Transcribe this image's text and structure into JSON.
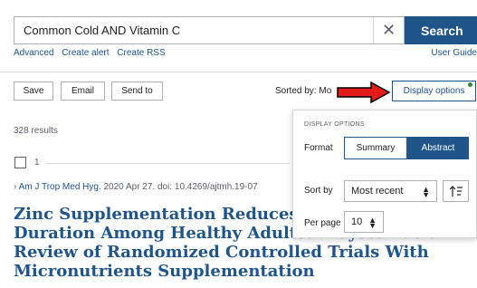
{
  "search": {
    "value": "Common Cold AND Vitamin C",
    "clear_glyph": "✕",
    "button_label": "Search"
  },
  "links": {
    "advanced": "Advanced",
    "create_alert": "Create alert",
    "create_rss": "Create RSS",
    "user_guide": "User Guide"
  },
  "toolbar": {
    "save": "Save",
    "email": "Email",
    "send_to": "Send to",
    "sorted_by": "Sorted by: Mo",
    "display_options": "Display options"
  },
  "results": {
    "count": "328 results"
  },
  "item": {
    "number": "1",
    "journal": "Am J Trop Med Hyg.",
    "citation_rest": " 2020 Apr 27. doi: 10.4269/ajtmh.19-07",
    "title": "Zinc Supplementation Reduces Common Cold Duration Among Healthy Adults: A Systematic Review of Randomized Controlled Trials With Micronutrients Supplementation"
  },
  "display_panel": {
    "heading": "DISPLAY OPTIONS",
    "format_label": "Format",
    "format_options": [
      "Summary",
      "Abstract"
    ],
    "format_selected": "Abstract",
    "sort_label": "Sort by",
    "sort_value": "Most recent",
    "per_page_label": "Per page",
    "per_page_value": "10"
  },
  "colors": {
    "primary": "#20558a",
    "indicator": "#2e8540",
    "annotation_arrow": "#e31b1b"
  },
  "icons": {
    "clear": "close-icon",
    "sort_direction": "sort-direction-icon",
    "result_bullet": "chevron-right-icon"
  }
}
